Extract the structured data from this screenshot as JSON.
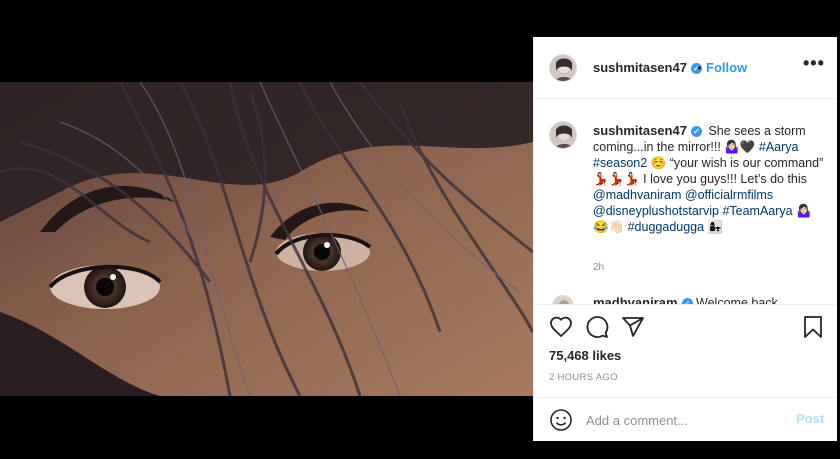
{
  "post": {
    "username": "sushmitasen47",
    "verified_icon": "verified-badge-icon",
    "follow_label": "Follow",
    "dot": "•",
    "more_label": "•••",
    "caption_parts": [
      {
        "text": "She sees a storm coming...in the mirror!!! 🤷🏻‍♀️🖤 ",
        "link": false
      },
      {
        "text": "#Aarya",
        "link": true
      },
      {
        "text": " ",
        "link": false
      },
      {
        "text": "#season2",
        "link": true
      },
      {
        "text": " ☺️ “your wish is our command” 💃🏻💃🏻💃🏻 I love you guys!!! Let’s do this ",
        "link": false
      },
      {
        "text": "@madhvaniram",
        "link": true
      },
      {
        "text": " ",
        "link": false
      },
      {
        "text": "@officialrmfilms",
        "link": true
      },
      {
        "text": " ",
        "link": false
      },
      {
        "text": "@disneyplushotstarvip",
        "link": true
      },
      {
        "text": " ",
        "link": false
      },
      {
        "text": "#TeamAarya",
        "link": true
      },
      {
        "text": " 🤷🏻‍♀️😂👋🏻 ",
        "link": false
      },
      {
        "text": "#duggadugga",
        "link": true
      },
      {
        "text": " 👩‍👧",
        "link": false
      }
    ],
    "caption_age": "2h",
    "next_comment_user": "madhvaniram",
    "next_comment_text": "Welcome back",
    "likes": "75,468 likes",
    "timestamp": "2 HOURS AGO",
    "comment_placeholder": "Add a comment...",
    "post_label": "Post"
  },
  "icons": {
    "like": "heart-icon",
    "comment": "comment-icon",
    "share": "share-icon",
    "save": "bookmark-icon",
    "emoji": "emoji-icon"
  },
  "colors": {
    "accent": "#3897f0",
    "link": "#00376b",
    "muted": "#8e8e8e",
    "post_disabled": "#b2dffc"
  }
}
